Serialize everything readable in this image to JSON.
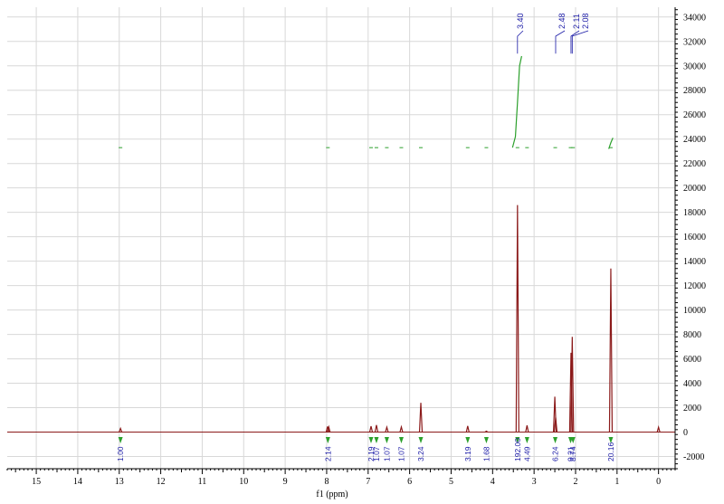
{
  "chart_data": {
    "type": "line",
    "title": "",
    "xlabel": "f1 (ppm)",
    "ylabel": "",
    "xlim": [
      15.7,
      -0.4
    ],
    "ylim": [
      -3000,
      34800
    ],
    "x_ticks": [
      15,
      14,
      13,
      12,
      11,
      10,
      9,
      8,
      7,
      6,
      5,
      4,
      3,
      2,
      1,
      0
    ],
    "y_ticks": [
      -2000,
      0,
      2000,
      4000,
      6000,
      8000,
      10000,
      12000,
      14000,
      16000,
      18000,
      20000,
      22000,
      24000,
      26000,
      28000,
      30000,
      32000,
      34000
    ],
    "grid": true,
    "series": [
      {
        "values": [
          {
            "x": 12.97,
            "y": 300
          },
          {
            "x": 7.98,
            "y": 450
          },
          {
            "x": 7.95,
            "y": 420
          },
          {
            "x": 6.93,
            "y": 480
          },
          {
            "x": 6.8,
            "y": 580
          },
          {
            "x": 6.55,
            "y": 400
          },
          {
            "x": 6.2,
            "y": 420
          },
          {
            "x": 5.73,
            "y": 2400
          },
          {
            "x": 4.6,
            "y": 500
          },
          {
            "x": 4.15,
            "y": 80
          },
          {
            "x": 3.4,
            "y": 18600
          },
          {
            "x": 3.17,
            "y": 550
          },
          {
            "x": 2.5,
            "y": 2900
          },
          {
            "x": 2.48,
            "y": 1200
          },
          {
            "x": 2.11,
            "y": 6500
          },
          {
            "x": 2.08,
            "y": 7800
          },
          {
            "x": 1.15,
            "y": 13400
          },
          {
            "x": 0.0,
            "y": 400
          }
        ]
      }
    ],
    "integral_curve": [
      {
        "x": 3.52,
        "y": 23300
      },
      {
        "x": 3.45,
        "y": 24200
      },
      {
        "x": 3.4,
        "y": 27000
      },
      {
        "x": 3.35,
        "y": 30000
      },
      {
        "x": 3.3,
        "y": 30800
      },
      {
        "x": 1.2,
        "y": 23200
      },
      {
        "x": 1.15,
        "y": 23700
      },
      {
        "x": 1.1,
        "y": 24100
      }
    ],
    "peak_labels": [
      "3.40",
      "2.48",
      "2.11",
      "2.08"
    ],
    "peak_label_x": [
      3.4,
      2.48,
      2.11,
      2.08
    ],
    "integrals": [
      {
        "x": 12.97,
        "label": "1.00"
      },
      {
        "x": 7.97,
        "label": "2.14"
      },
      {
        "x": 6.93,
        "label": "2.19"
      },
      {
        "x": 6.8,
        "label": "1.07"
      },
      {
        "x": 6.55,
        "label": "1.07"
      },
      {
        "x": 6.2,
        "label": "1.07"
      },
      {
        "x": 5.73,
        "label": "3.24"
      },
      {
        "x": 4.6,
        "label": "3.19"
      },
      {
        "x": 4.15,
        "label": "1.68"
      },
      {
        "x": 3.4,
        "label": "192.00"
      },
      {
        "x": 3.17,
        "label": "4.49"
      },
      {
        "x": 2.49,
        "label": "6.24"
      },
      {
        "x": 2.12,
        "label": "9.21"
      },
      {
        "x": 2.06,
        "label": "8.74"
      },
      {
        "x": 1.15,
        "label": "20.16"
      }
    ],
    "colors": {
      "spectrum": "#8b1a1a",
      "integral": "#2ca02c",
      "labels": "#1a1aa6",
      "grid": "#d8d8d8",
      "axis": "#000000"
    }
  }
}
